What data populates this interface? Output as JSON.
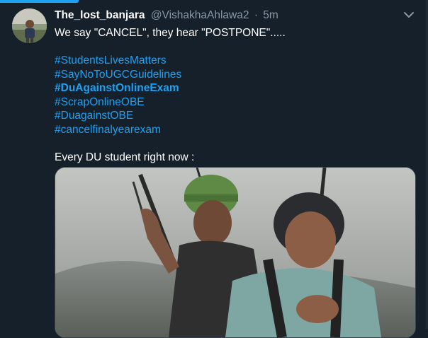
{
  "tweet": {
    "display_name": "The_lost_banjara",
    "handle": "@VishakhaAhlawa2",
    "separator": "·",
    "time": "5m",
    "text_line": "We say \"CANCEL\", they hear \"POSTPONE\".....",
    "hashtags": [
      "#StudentsLivesMatters",
      "#SayNoToUGCGuidelines",
      "#DuAgainstOnlineExam",
      "#ScrapOnlineOBE",
      "#DuagainstOBE",
      "#cancelfinalyearexam"
    ],
    "closing_line": "Every DU student right now :"
  },
  "icons": {
    "menu": "chevron-down-icon",
    "avatar": "user-avatar"
  },
  "colors": {
    "background": "#15202b",
    "accent": "#1da1f2",
    "muted_text": "#8899a6",
    "border": "#38444d"
  }
}
